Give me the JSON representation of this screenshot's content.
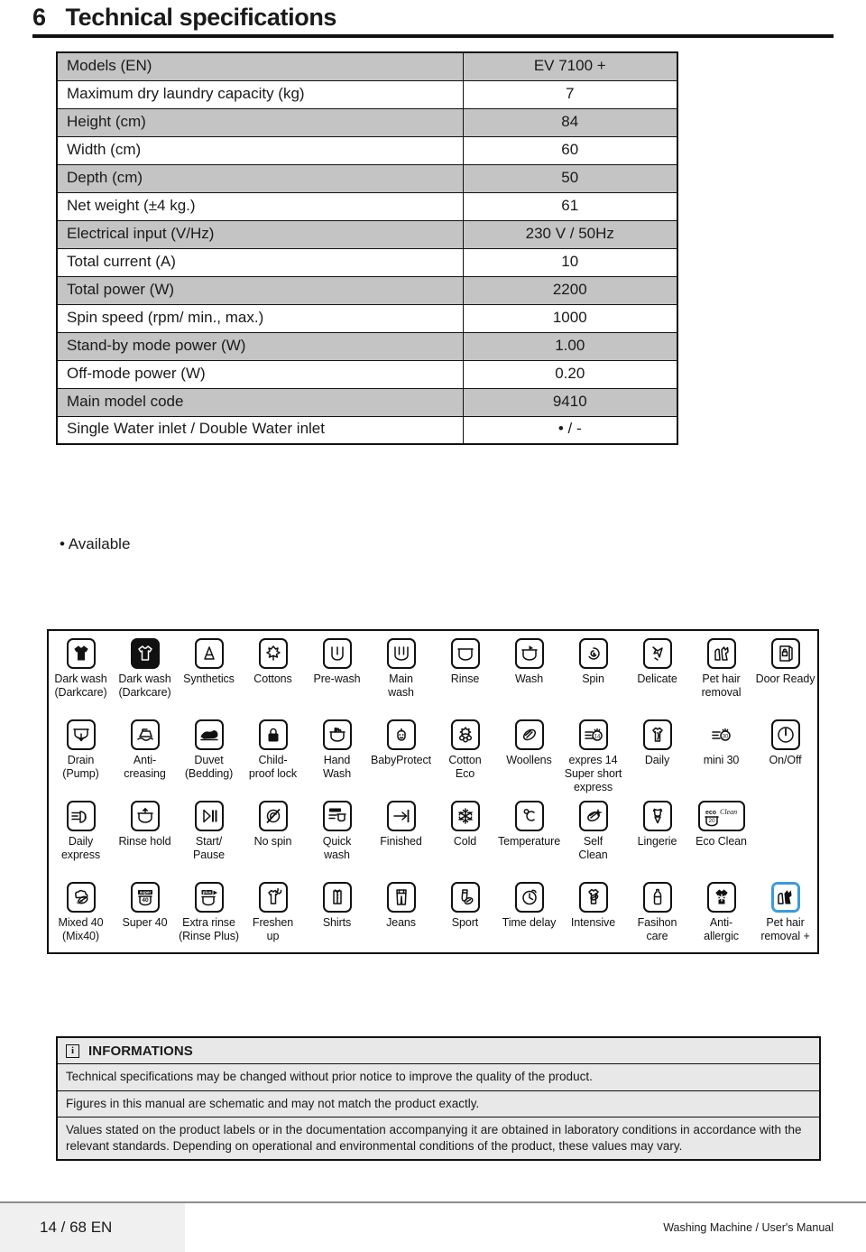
{
  "chapter": {
    "number": "6",
    "title": "Technical specifications"
  },
  "spec_table": {
    "rows": [
      {
        "label": "Models (EN)",
        "value": "EV 7100 +",
        "shaded": true
      },
      {
        "label": "Maximum dry laundry capacity (kg)",
        "value": "7",
        "shaded": false
      },
      {
        "label": "Height (cm)",
        "value": "84",
        "shaded": true
      },
      {
        "label": "Width (cm)",
        "value": "60",
        "shaded": false
      },
      {
        "label": "Depth (cm)",
        "value": "50",
        "shaded": true
      },
      {
        "label": "Net weight (±4 kg.)",
        "value": "61",
        "shaded": false
      },
      {
        "label": "Electrical input (V/Hz)",
        "value": "230 V / 50Hz",
        "shaded": true
      },
      {
        "label": "Total current (A)",
        "value": "10",
        "shaded": false
      },
      {
        "label": "Total power (W)",
        "value": "2200",
        "shaded": true
      },
      {
        "label": "Spin speed (rpm/ min., max.)",
        "value": "1000",
        "shaded": false
      },
      {
        "label": "Stand-by mode power (W)",
        "value": "1.00",
        "shaded": true
      },
      {
        "label": "Off-mode power (W)",
        "value": "0.20",
        "shaded": false
      },
      {
        "label": "Main model code",
        "value": "9410",
        "shaded": true
      },
      {
        "label": "Single Water inlet  / Double Water inlet",
        "value": "• / -",
        "shaded": false
      }
    ]
  },
  "available_note": "• Available",
  "icon_legend": {
    "rows": [
      [
        {
          "label": "Dark wash\n(Darkcare)",
          "icon": "dark-wash-filled"
        },
        {
          "label": "Dark wash\n(Darkcare)",
          "icon": "dark-wash-inverted"
        },
        {
          "label": "Synthetics",
          "icon": "synthetics"
        },
        {
          "label": "Cottons",
          "icon": "cottons"
        },
        {
          "label": "Pre-wash",
          "icon": "pre-wash"
        },
        {
          "label": "Main\nwash",
          "icon": "main-wash"
        },
        {
          "label": "Rinse",
          "icon": "rinse"
        },
        {
          "label": "Wash",
          "icon": "wash"
        },
        {
          "label": "Spin",
          "icon": "spin"
        },
        {
          "label": "Delicate",
          "icon": "delicate"
        },
        {
          "label": "Pet hair\nremoval",
          "icon": "pet-hair-removal"
        },
        {
          "label": "Door Ready",
          "icon": "door-ready"
        }
      ],
      [
        {
          "label": "Drain\n(Pump)",
          "icon": "drain-pump"
        },
        {
          "label": "Anti-\ncreasing",
          "icon": "anti-creasing"
        },
        {
          "label": "Duvet\n(Bedding)",
          "icon": "duvet-bedding"
        },
        {
          "label": "Child-\nproof lock",
          "icon": "child-proof-lock"
        },
        {
          "label": "Hand\nWash",
          "icon": "hand-wash"
        },
        {
          "label": "BabyProtect",
          "icon": "baby-protect"
        },
        {
          "label": "Cotton\nEco",
          "icon": "cotton-eco"
        },
        {
          "label": "Woollens",
          "icon": "woollens"
        },
        {
          "label": "expres 14\nSuper short\nexpress",
          "icon": "express-14"
        },
        {
          "label": "Daily",
          "icon": "daily"
        },
        {
          "label": "mini 30",
          "icon": "mini-30"
        },
        {
          "label": "On/Off",
          "icon": "on-off"
        }
      ],
      [
        {
          "label": "Daily\nexpress",
          "icon": "daily-express"
        },
        {
          "label": "Rinse hold",
          "icon": "rinse-hold"
        },
        {
          "label": "Start/\nPause",
          "icon": "start-pause"
        },
        {
          "label": "No spin",
          "icon": "no-spin"
        },
        {
          "label": "Quick\nwash",
          "icon": "quick-wash"
        },
        {
          "label": "Finished",
          "icon": "finished"
        },
        {
          "label": "Cold",
          "icon": "cold"
        },
        {
          "label": "Temperature",
          "icon": "temperature"
        },
        {
          "label": "Self\nClean",
          "icon": "self-clean"
        },
        {
          "label": "Lingerie",
          "icon": "lingerie"
        },
        {
          "label": "Eco Clean",
          "icon": "eco-clean"
        },
        {
          "label": "",
          "icon": "blank"
        }
      ],
      [
        {
          "label": "Mixed 40\n(Mix40)",
          "icon": "mixed-40"
        },
        {
          "label": "Super 40",
          "icon": "super-40"
        },
        {
          "label": "Extra rinse\n(Rinse Plus)",
          "icon": "extra-rinse"
        },
        {
          "label": "Freshen\nup",
          "icon": "freshen-up"
        },
        {
          "label": "Shirts",
          "icon": "shirts"
        },
        {
          "label": "Jeans",
          "icon": "jeans"
        },
        {
          "label": "Sport",
          "icon": "sport"
        },
        {
          "label": "Time delay",
          "icon": "time-delay"
        },
        {
          "label": "Intensive",
          "icon": "intensive"
        },
        {
          "label": "Fasihon\ncare",
          "icon": "fashion-care"
        },
        {
          "label": "Anti-\nallergic",
          "icon": "anti-allergic"
        },
        {
          "label": "Pet hair\nremoval +",
          "icon": "pet-hair-removal-plus"
        }
      ]
    ],
    "selected_accent": "#3a9ade"
  },
  "informations": {
    "icon": "info-icon",
    "title": "INFORMATIONS",
    "lines": [
      "Technical specifications may be changed without prior notice to improve the quality of the product.",
      "Figures in this manual are schematic and may not match the product exactly.",
      "Values stated on the product labels or in the documentation accompanying it are obtained in laboratory conditions in accordance with the relevant standards. Depending on operational and environmental conditions of the product, these values may vary."
    ]
  },
  "footer": {
    "page": "14 / 68 EN",
    "manual": "Washing Machine / User's Manual"
  }
}
